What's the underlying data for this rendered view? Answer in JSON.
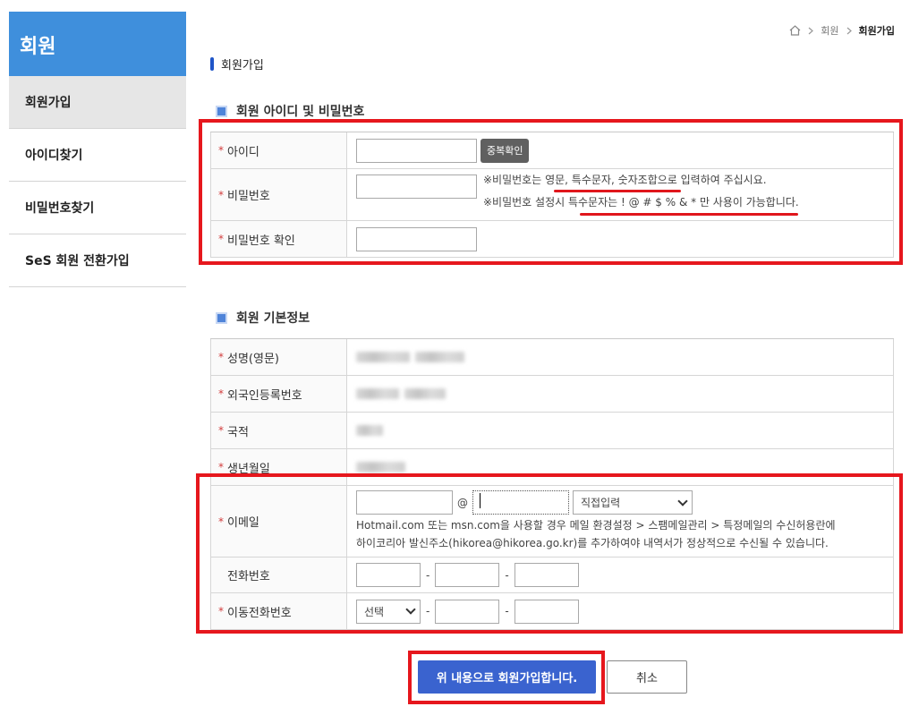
{
  "sidebar": {
    "title": "회원",
    "items": [
      {
        "label": "회원가입",
        "active": true
      },
      {
        "label": "아이디찾기",
        "active": false
      },
      {
        "label": "비밀번호찾기",
        "active": false
      },
      {
        "label": "SeS 회원 전환가입",
        "active": false
      }
    ]
  },
  "breadcrumb": {
    "level1": "회원",
    "current": "회원가입"
  },
  "page_title": "회원가입",
  "section_account": {
    "title": "회원 아이디 및 비밀번호",
    "id_label": "아이디",
    "dup_check_label": "중복확인",
    "pw_label": "비밀번호",
    "pw_note1": "※비밀번호는 영문, 특수문자, 숫자조합으로 입력하여 주십시요.",
    "pw_note2": "※비밀번호 설정시 특수문자는 ! @ # $ % & * 만 사용이 가능합니다.",
    "pw_confirm_label": "비밀번호 확인"
  },
  "section_basic": {
    "title": "회원 기본정보",
    "name_label": "성명(영문)",
    "alien_reg_label": "외국인등록번호",
    "nationality_label": "국적",
    "birth_label": "생년월일",
    "email_label": "이메일",
    "email_at": "@",
    "email_domain_select": "직접입력",
    "email_note1": "Hotmail.com 또는 msn.com을 사용할 경우 메일 환경설정 > 스팸메일관리 > 특정메일의 수신허용란에",
    "email_note2": "하이코리아 발신주소(hikorea@hikorea.go.kr)를 추가하여야 내역서가 정상적으로 수신될 수 있습니다.",
    "phone_label": "전화번호",
    "mobile_label": "이동전화번호",
    "mobile_select": "선택",
    "dash": "-"
  },
  "buttons": {
    "submit": "위 내용으로 회원가입합니다.",
    "cancel": "취소"
  },
  "colors": {
    "accent": "#3f8fdc",
    "submit": "#3a63cf",
    "highlight": "#e6171d"
  }
}
